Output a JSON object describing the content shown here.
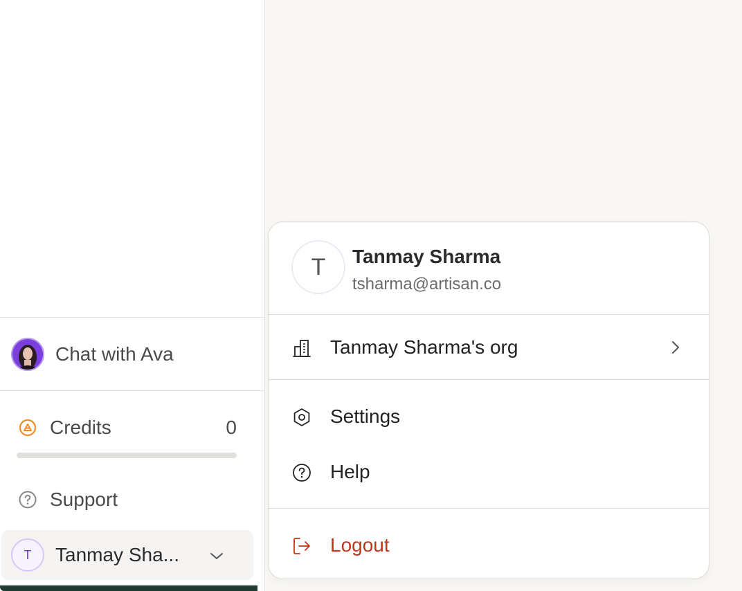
{
  "sidebar": {
    "chat": {
      "label": "Chat with Ava",
      "avatar_icon": "ava-avatar"
    },
    "credits": {
      "label": "Credits",
      "value": "0",
      "progress": 0,
      "accent": "#f08a24"
    },
    "support": {
      "label": "Support"
    },
    "user": {
      "initial": "T",
      "name": "Tanmay Sha...",
      "chevron_icon": "chevron-down-icon"
    }
  },
  "menu": {
    "header": {
      "initial": "T",
      "name": "Tanmay Sharma",
      "email": "tsharma@artisan.co"
    },
    "items": [
      {
        "label": "Tanmay Sharma's org",
        "icon": "building-icon",
        "has_submenu": true
      },
      {
        "label": "Settings",
        "icon": "gear-hex-icon"
      },
      {
        "label": "Help",
        "icon": "help-circle-icon"
      },
      {
        "label": "Logout",
        "icon": "logout-icon",
        "color": "#c0341d"
      }
    ]
  }
}
